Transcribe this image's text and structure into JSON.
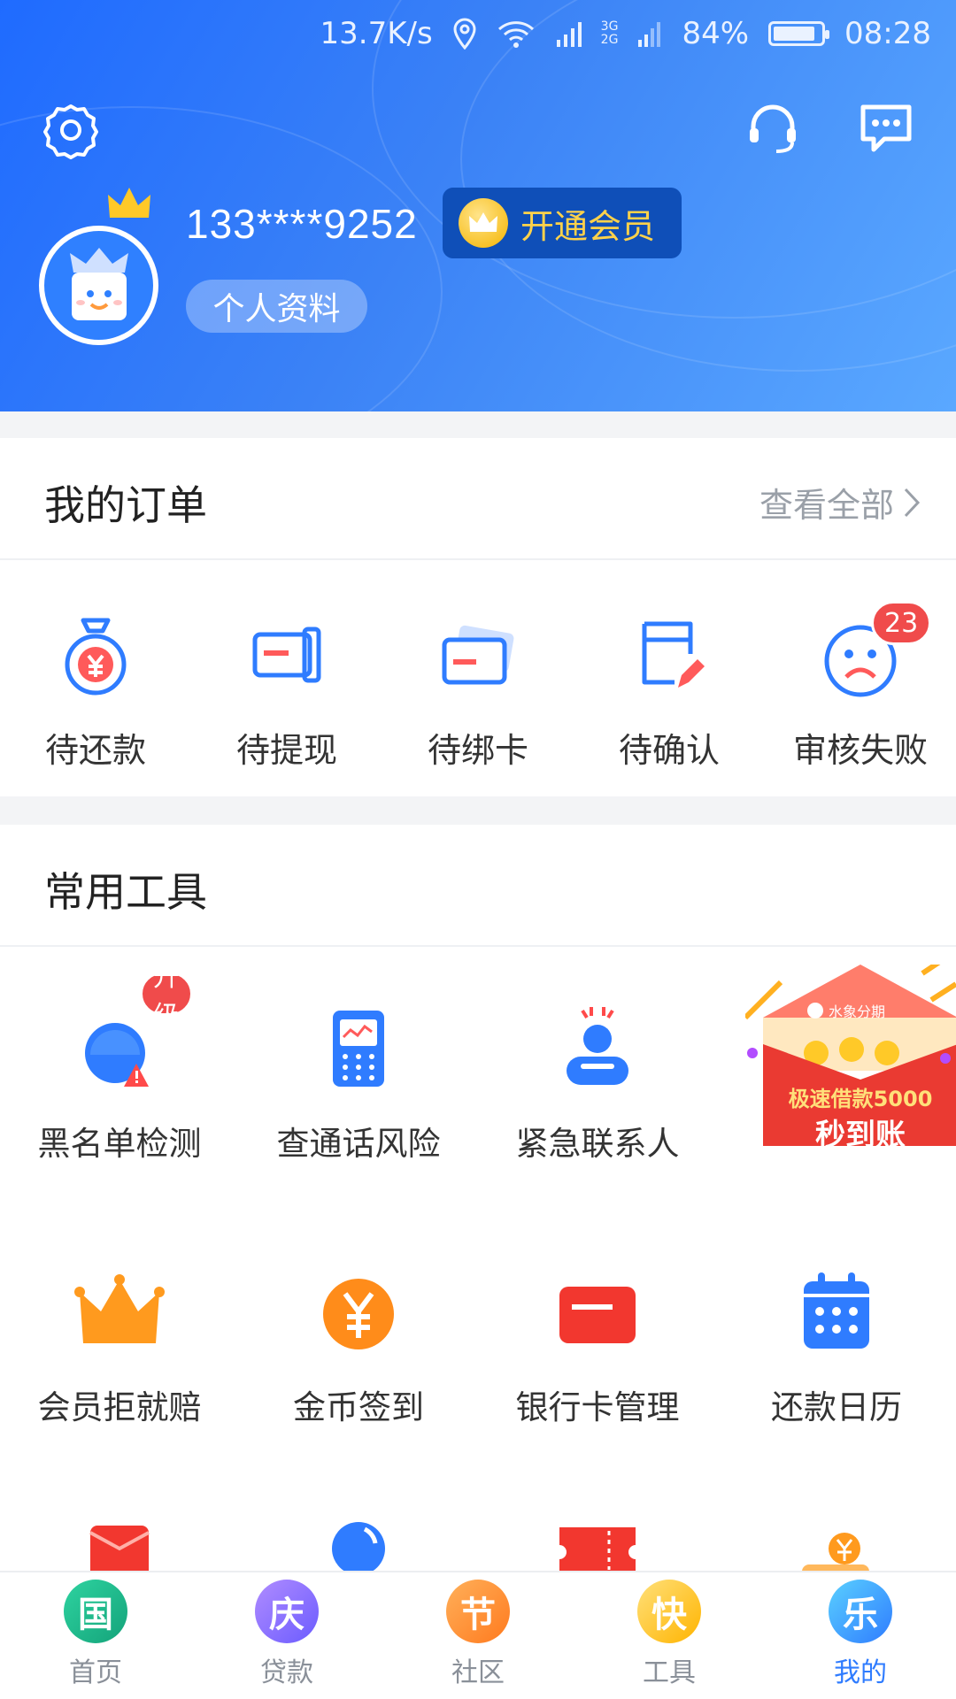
{
  "status_bar": {
    "speed": "13.7K/s",
    "battery": "84%",
    "time": "08:28",
    "net_3g": "3G",
    "net_2g": "2G"
  },
  "profile": {
    "phone": "133****9252",
    "vip_label": "开通会员",
    "profile_label": "个人资料"
  },
  "orders": {
    "title": "我的订单",
    "view_all": "查看全部",
    "items": [
      {
        "label": "待还款",
        "icon": "money-bag-icon"
      },
      {
        "label": "待提现",
        "icon": "withdraw-icon"
      },
      {
        "label": "待绑卡",
        "icon": "bank-card-icon"
      },
      {
        "label": "待确认",
        "icon": "confirm-doc-icon"
      },
      {
        "label": "审核失败",
        "icon": "sad-face-icon",
        "badge": "23"
      }
    ]
  },
  "tools": {
    "title": "常用工具",
    "row1": [
      {
        "label": "黑名单检测",
        "icon": "blacklist-icon",
        "badge": "升级"
      },
      {
        "label": "查通话风险",
        "icon": "phone-risk-icon"
      },
      {
        "label": "紧急联系人",
        "icon": "contact-icon"
      }
    ],
    "promo": {
      "brand": "水象分期",
      "line1": "极速借款5000",
      "line2": "秒到账"
    },
    "row2": [
      {
        "label": "会员拒就赔",
        "icon": "crown-icon"
      },
      {
        "label": "金币签到",
        "icon": "coin-icon"
      },
      {
        "label": "银行卡管理",
        "icon": "card-manage-icon"
      },
      {
        "label": "还款日历",
        "icon": "calendar-icon"
      }
    ]
  },
  "tabbar": [
    {
      "char": "国",
      "label": "首页"
    },
    {
      "char": "庆",
      "label": "贷款"
    },
    {
      "char": "节",
      "label": "社区"
    },
    {
      "char": "快",
      "label": "工具"
    },
    {
      "char": "乐",
      "label": "我的",
      "active": true
    }
  ],
  "colors": {
    "primary": "#2f7cff",
    "badge": "#f04b4b",
    "header_start": "#1f6bff",
    "header_end": "#5aa8ff"
  }
}
